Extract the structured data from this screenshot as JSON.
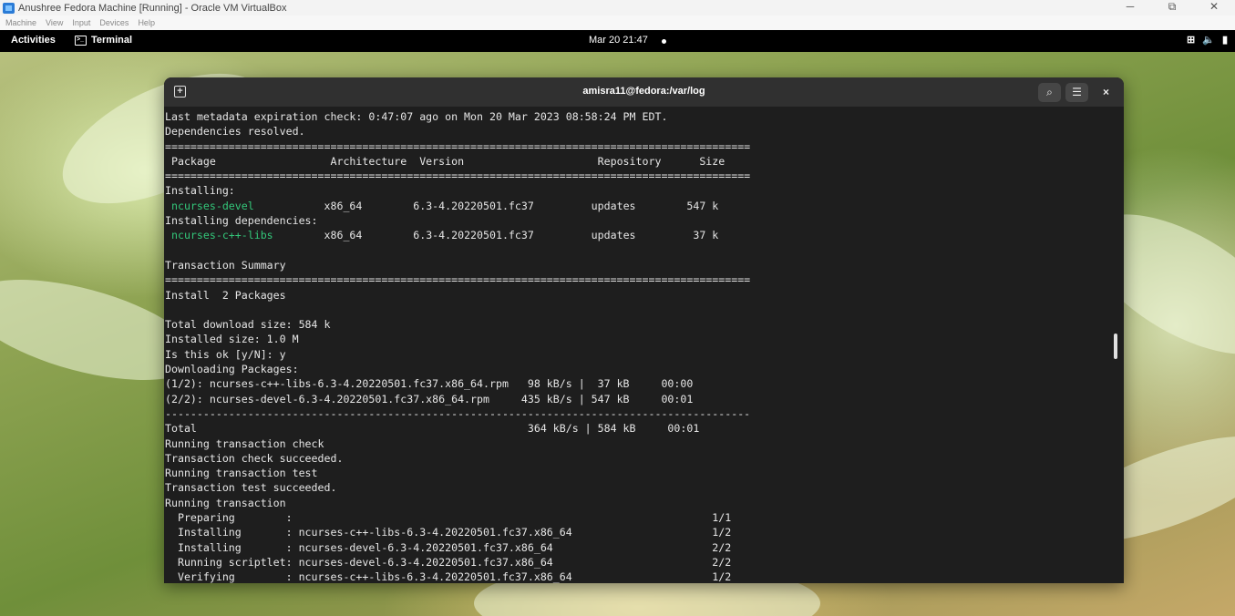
{
  "vbox": {
    "title": "Anushree Fedora Machine [Running] - Oracle VM VirtualBox",
    "menu": [
      "Machine",
      "View",
      "Input",
      "Devices",
      "Help"
    ],
    "minimize": "─",
    "maximize": "⧉",
    "close": "✕"
  },
  "gnome": {
    "activities": "Activities",
    "app_name": "Terminal",
    "clock": "Mar 20  21:47"
  },
  "terminal": {
    "title": "amisra11@fedora:/var/log",
    "lines": [
      "Last metadata expiration check: 0:47:07 ago on Mon 20 Mar 2023 08:58:24 PM EDT.",
      "Dependencies resolved.",
      "============================================================================================",
      " Package                  Architecture  Version                     Repository      Size",
      "============================================================================================",
      "Installing:",
      " @@ncurses-devel@@           x86_64        6.3-4.20220501.fc37         updates        547 k",
      "Installing dependencies:",
      " @@ncurses-c++-libs@@        x86_64        6.3-4.20220501.fc37         updates         37 k",
      "",
      "Transaction Summary",
      "============================================================================================",
      "Install  2 Packages",
      "",
      "Total download size: 584 k",
      "Installed size: 1.0 M",
      "Is this ok [y/N]: y",
      "Downloading Packages:",
      "(1/2): ncurses-c++-libs-6.3-4.20220501.fc37.x86_64.rpm   98 kB/s |  37 kB     00:00",
      "(2/2): ncurses-devel-6.3-4.20220501.fc37.x86_64.rpm     435 kB/s | 547 kB     00:01",
      "--------------------------------------------------------------------------------------------",
      "Total                                                    364 kB/s | 584 kB     00:01",
      "Running transaction check",
      "Transaction check succeeded.",
      "Running transaction test",
      "Transaction test succeeded.",
      "Running transaction",
      "  Preparing        :                                                                  1/1",
      "  Installing       : ncurses-c++-libs-6.3-4.20220501.fc37.x86_64                      1/2",
      "  Installing       : ncurses-devel-6.3-4.20220501.fc37.x86_64                         2/2",
      "  Running scriptlet: ncurses-devel-6.3-4.20220501.fc37.x86_64                         2/2",
      "  Verifying        : ncurses-c++-libs-6.3-4.20220501.fc37.x86_64                      1/2"
    ]
  },
  "colors": {
    "terminal_bg": "#1e1e1e",
    "terminal_header": "#303030",
    "package_highlight": "#33c77a",
    "topbar": "#000000"
  },
  "icons": {
    "network": "network-icon",
    "volume": "volume-icon",
    "battery": "battery-icon",
    "search": "search-icon",
    "menu": "hamburger-menu-icon",
    "new_tab": "new-tab-icon"
  }
}
